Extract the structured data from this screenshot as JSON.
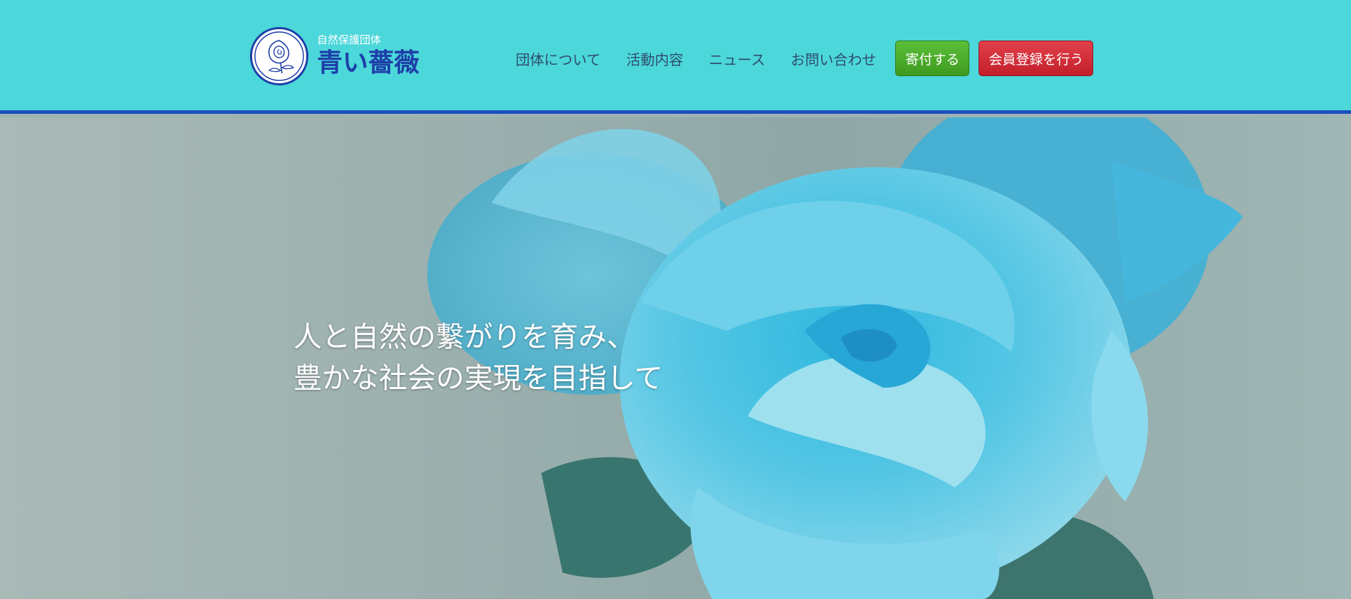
{
  "header": {
    "logo": {
      "subtitle": "自然保護団体",
      "name": "青い薔薇",
      "icon": "rose-emblem-icon"
    },
    "nav": [
      {
        "label": "団体について"
      },
      {
        "label": "活動内容"
      },
      {
        "label": "ニュース"
      },
      {
        "label": "お問い合わせ"
      }
    ],
    "donate_button": "寄付する",
    "join_button": "会員登録を行う",
    "colors": {
      "header_bg": "#4cd7da",
      "header_border": "#1a4fbf",
      "donate": "#4cac2a",
      "join": "#d32f3a",
      "brand_blue": "#1d3fa8"
    }
  },
  "hero": {
    "image": "blue-rose-photo",
    "line1": "人と自然の繋がりを育み、",
    "line2": "豊かな社会の実現を目指して"
  }
}
